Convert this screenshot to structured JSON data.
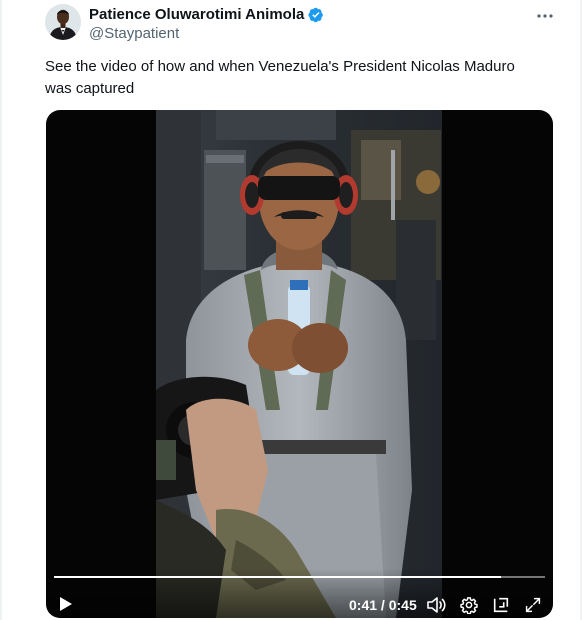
{
  "author": {
    "name": "Patience Oluwarotimi Animola",
    "handle": "@Staypatient",
    "verified": true,
    "verified_color": "#1d9bf0"
  },
  "tweet": {
    "text": "See the video of how and when Venezuela's President Nicolas Maduro was captured"
  },
  "video": {
    "current_time": "0:41",
    "separator": " / ",
    "duration": "0:45",
    "progress_fraction": 0.911
  },
  "icons": {
    "more": "more-horizontal-icon",
    "play": "play-icon",
    "volume": "volume-icon",
    "settings": "settings-gear-icon",
    "pip": "picture-in-picture-icon",
    "fullscreen": "fullscreen-icon"
  },
  "colors": {
    "text_primary": "#0f1419",
    "text_secondary": "#536471",
    "video_background": "#050505"
  }
}
